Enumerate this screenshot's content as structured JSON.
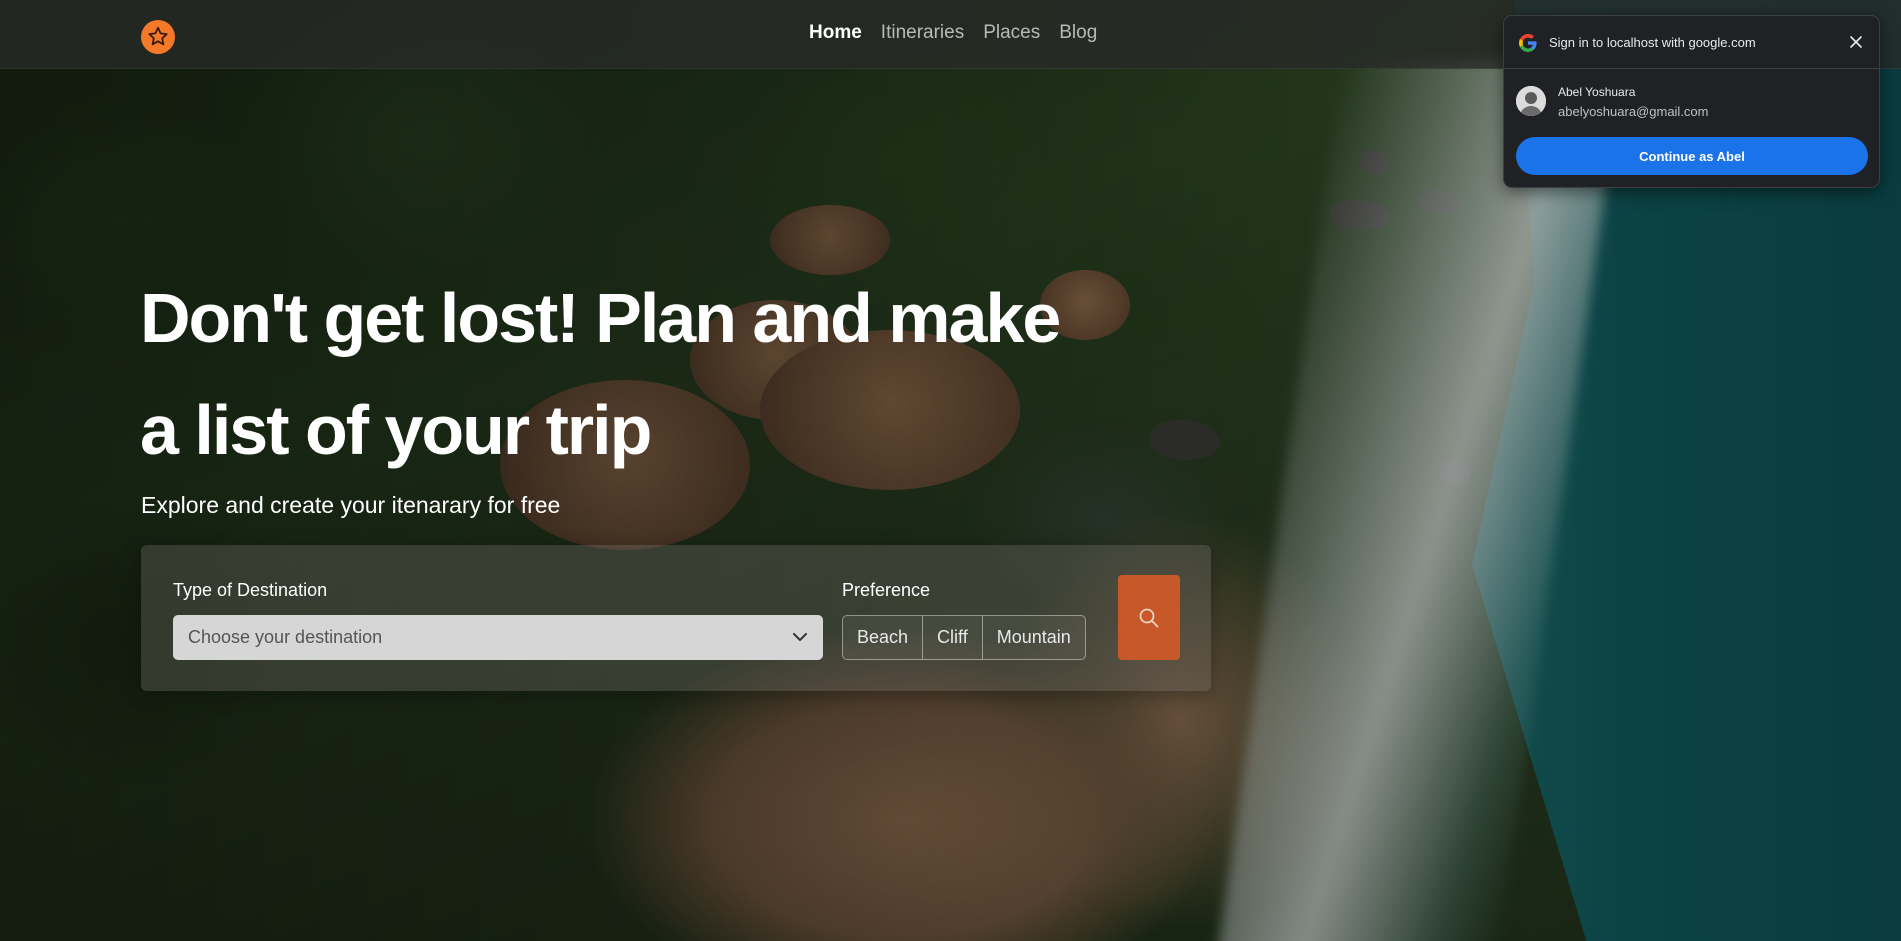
{
  "colors": {
    "brand_orange": "#f47a2a",
    "search_button": "#c6582a",
    "google_blue": "#1a73e8",
    "popup_bg": "#202124"
  },
  "navbar": {
    "logo_icon": "star-logo-icon",
    "links": [
      {
        "label": "Home",
        "active": true
      },
      {
        "label": "Itineraries",
        "active": false
      },
      {
        "label": "Places",
        "active": false
      },
      {
        "label": "Blog",
        "active": false
      }
    ]
  },
  "hero": {
    "title_line1": "Don't get lost! Plan and make",
    "title_line2": "a list of your trip",
    "subtitle": "Explore and create your itenarary for free"
  },
  "search": {
    "destination_label": "Type of Destination",
    "destination_placeholder": "Choose your destination",
    "preference_label": "Preference",
    "preferences": [
      "Beach",
      "Cliff",
      "Mountain"
    ],
    "search_icon": "search-icon"
  },
  "google_signin": {
    "title": "Sign in to localhost with google.com",
    "account_name": "Abel Yoshuara",
    "account_email": "abelyoshuara@gmail.com",
    "continue_label": "Continue as Abel",
    "close_icon": "close-icon"
  }
}
